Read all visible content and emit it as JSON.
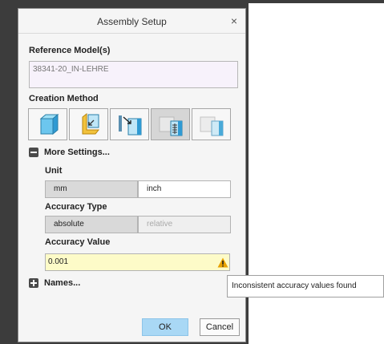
{
  "dialog": {
    "title": "Assembly Setup",
    "close_glyph": "×"
  },
  "reference": {
    "label": "Reference Model(s)",
    "value": "38341-20_IN-LEHRE"
  },
  "creation": {
    "label": "Creation Method",
    "buttons": [
      {
        "icon": "cube-icon"
      },
      {
        "icon": "corner-placement-icon"
      },
      {
        "icon": "arrow-into-frame-icon"
      },
      {
        "icon": "ruler-frame-icon"
      },
      {
        "icon": "frame-corner-icon"
      }
    ],
    "selected_index": 3
  },
  "more_settings": {
    "label": "More Settings...",
    "unit_label": "Unit",
    "unit_options": [
      "mm",
      "inch"
    ],
    "unit_selected": "mm",
    "accuracy_type_label": "Accuracy Type",
    "accuracy_type_options": [
      "absolute",
      "relative"
    ],
    "accuracy_type_selected": "absolute",
    "accuracy_value_label": "Accuracy Value",
    "accuracy_value": "0.001"
  },
  "names": {
    "label": "Names..."
  },
  "buttons": {
    "ok": "OK",
    "cancel": "Cancel"
  },
  "tooltip": {
    "text": "Inconsistent accuracy values found"
  },
  "colors": {
    "accent_ok": "#a9d8f5",
    "warning": "#e8a200",
    "input_highlight": "#fdfbc8"
  }
}
